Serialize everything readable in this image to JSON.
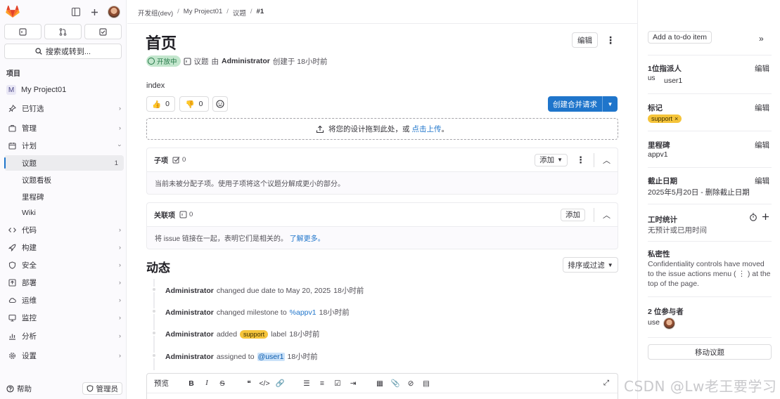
{
  "sidebar": {
    "search_label": "搜索或转到...",
    "section_label": "项目",
    "project_initial": "M",
    "project_name": "My Project01",
    "items": [
      {
        "label": "已钉选",
        "icon": "pin-icon"
      },
      {
        "label": "管理",
        "icon": "briefcase-icon"
      },
      {
        "label": "计划",
        "icon": "calendar-icon"
      },
      {
        "label": "代码",
        "icon": "code-icon"
      },
      {
        "label": "构建",
        "icon": "rocket-icon"
      },
      {
        "label": "安全",
        "icon": "shield-icon"
      },
      {
        "label": "部署",
        "icon": "deploy-icon"
      },
      {
        "label": "运维",
        "icon": "cloud-icon"
      },
      {
        "label": "监控",
        "icon": "monitor-icon"
      },
      {
        "label": "分析",
        "icon": "chart-icon"
      },
      {
        "label": "设置",
        "icon": "gear-icon"
      }
    ],
    "plan_sub": [
      {
        "label": "议题",
        "badge": "1"
      },
      {
        "label": "议题看板"
      },
      {
        "label": "里程碑"
      },
      {
        "label": "Wiki"
      }
    ],
    "help_label": "帮助",
    "admin_label": "管理员"
  },
  "breadcrumb": [
    "开发组(dev)",
    "My Project01",
    "议题",
    "#1"
  ],
  "issue": {
    "title": "首页",
    "edit_label": "编辑",
    "status": "开放中",
    "type": "议题",
    "by": "由",
    "author": "Administrator",
    "created": "创建于 18小时前",
    "description": "index",
    "thumbs_up": "0",
    "thumbs_down": "0",
    "create_mr_label": "创建合并请求",
    "dropzone_text": "将您的设计拖到此处，或",
    "dropzone_link": "点击上传",
    "dropzone_end": "。"
  },
  "child_items": {
    "title": "子项",
    "count": "0",
    "add_label": "添加",
    "empty_text": "当前未被分配子项。使用子项将这个议题分解成更小的部分。"
  },
  "linked_items": {
    "title": "关联项",
    "count": "0",
    "add_label": "添加",
    "body_text": "将 issue 链接在一起，表明它们是相关的。",
    "learn_more": "了解更多。"
  },
  "activity": {
    "title": "动态",
    "sort_label": "排序或过滤",
    "events": [
      {
        "user": "Administrator",
        "text": "changed due date to May 20, 2025",
        "time": "18小时前"
      },
      {
        "user": "Administrator",
        "text": "changed milestone to",
        "ref": "%appv1",
        "time": "18小时前"
      },
      {
        "user": "Administrator",
        "text": "added",
        "label": "support",
        "text2": "label",
        "time": "18小时前"
      },
      {
        "user": "Administrator",
        "text": "assigned to",
        "mention": "@user1",
        "time": "18小时前"
      }
    ]
  },
  "editor": {
    "preview_label": "预览"
  },
  "right_panel": {
    "todo_label": "Add a to-do item",
    "assignee_title": "1位指派人",
    "assignee_edit": "编辑",
    "assignee_avatar_text": "us",
    "assignee_name": "user1",
    "labels_title": "标记",
    "labels_edit": "编辑",
    "label_value": "support",
    "milestone_title": "里程碑",
    "milestone_edit": "编辑",
    "milestone_value": "appv1",
    "due_title": "截止日期",
    "due_edit": "编辑",
    "due_value": "2025年5月20日 - 删除截止日期",
    "time_title": "工时统计",
    "time_value": "无预计或已用时间",
    "conf_title": "私密性",
    "conf_text_1": "Confidentiality controls have moved",
    "conf_text_2": "to the issue actions menu ( ⋮ ) at the",
    "conf_text_3": "top of the page.",
    "participants_title": "2 位参与者",
    "participant_text": "use",
    "move_label": "移动议题"
  },
  "watermark": "CSDN @Lw老王要学习",
  "colors": {
    "accent": "#1f75cb",
    "label": "#f5c43a",
    "open": "#217645"
  }
}
